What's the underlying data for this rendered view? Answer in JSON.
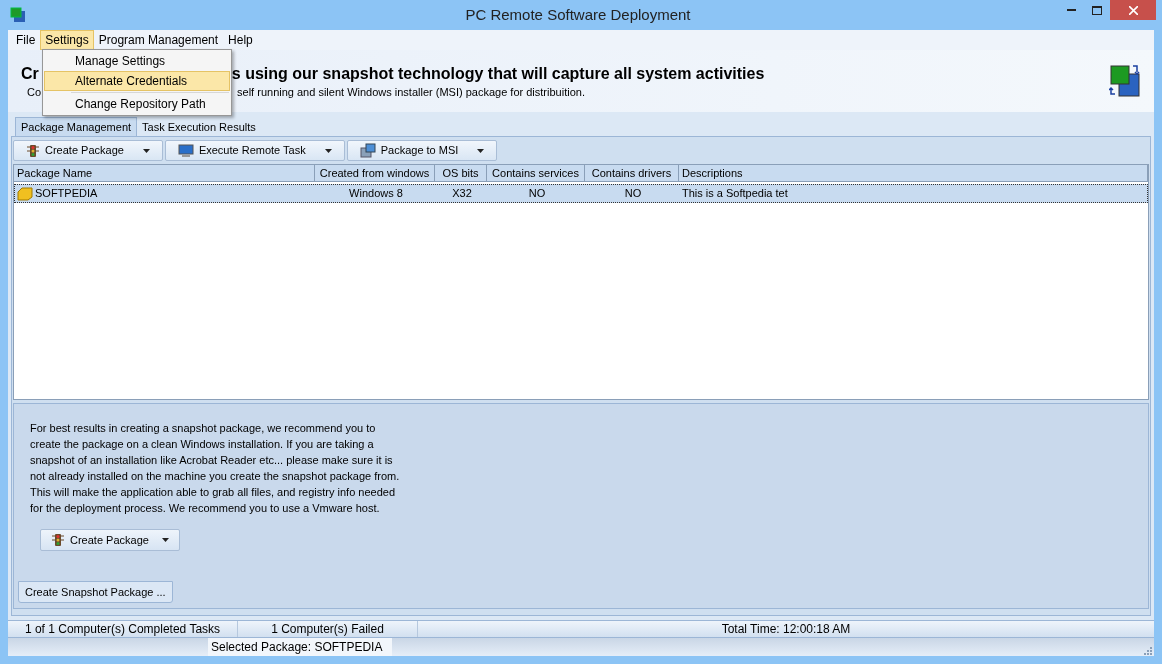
{
  "window": {
    "title": "PC Remote Software Deployment"
  },
  "menu_bar": [
    {
      "label": "File",
      "selected": false
    },
    {
      "label": "Settings",
      "selected": true
    },
    {
      "label": "Program Management",
      "selected": false
    },
    {
      "label": "Help",
      "selected": false
    }
  ],
  "settings_menu": [
    {
      "label": "Manage Settings",
      "selected": false
    },
    {
      "label": "Alternate Credentials",
      "selected": true
    },
    {
      "label": "Change Repository Path",
      "selected": false
    }
  ],
  "header": {
    "title_parts": [
      "Cr",
      "s using our snapshot technology that will capture all system activities"
    ],
    "subtitle_parts": [
      "Co",
      "self running and silent Windows installer (MSI) package for distribuition."
    ]
  },
  "tabs": [
    {
      "label": "Package Management",
      "selected": true
    },
    {
      "label": "Task Execution Results",
      "selected": false
    }
  ],
  "toolbar": [
    {
      "label": "Create Package",
      "kind": "traffic"
    },
    {
      "label": "Execute Remote Task",
      "kind": "monitor"
    },
    {
      "label": "Package to MSI",
      "kind": "package"
    }
  ],
  "table": {
    "columns": [
      "Package Name",
      "Created from windows",
      "OS bits",
      "Contains services",
      "Contains drivers",
      "Descriptions"
    ],
    "rows": [
      {
        "selected": true,
        "cells": [
          "SOFTPEDIA",
          "Windows 8",
          "X32",
          "NO",
          "NO",
          "This is a Softpedia tet"
        ]
      }
    ]
  },
  "info_panel": {
    "text": "For best results in creating a snapshot package, we recommend you to create the package on a clean Windows installation. If you are taking a snapshot of an installation like Acrobat Reader etc... please make sure it is not already installed on the machine you create the snapshot package from. This will make the application able to grab all files, and registry info needed for the deployment process. We recommend you to use a Vmware host.",
    "button": "Create Package",
    "tab": "Create Snapshot Package ..."
  },
  "status_bar": [
    "1 of 1 Computer(s) Completed Tasks",
    "1 Computer(s) Failed",
    "Total Time: 12:00:18 AM"
  ],
  "status_bar_2": "Selected Package: SOFTPEDIA"
}
